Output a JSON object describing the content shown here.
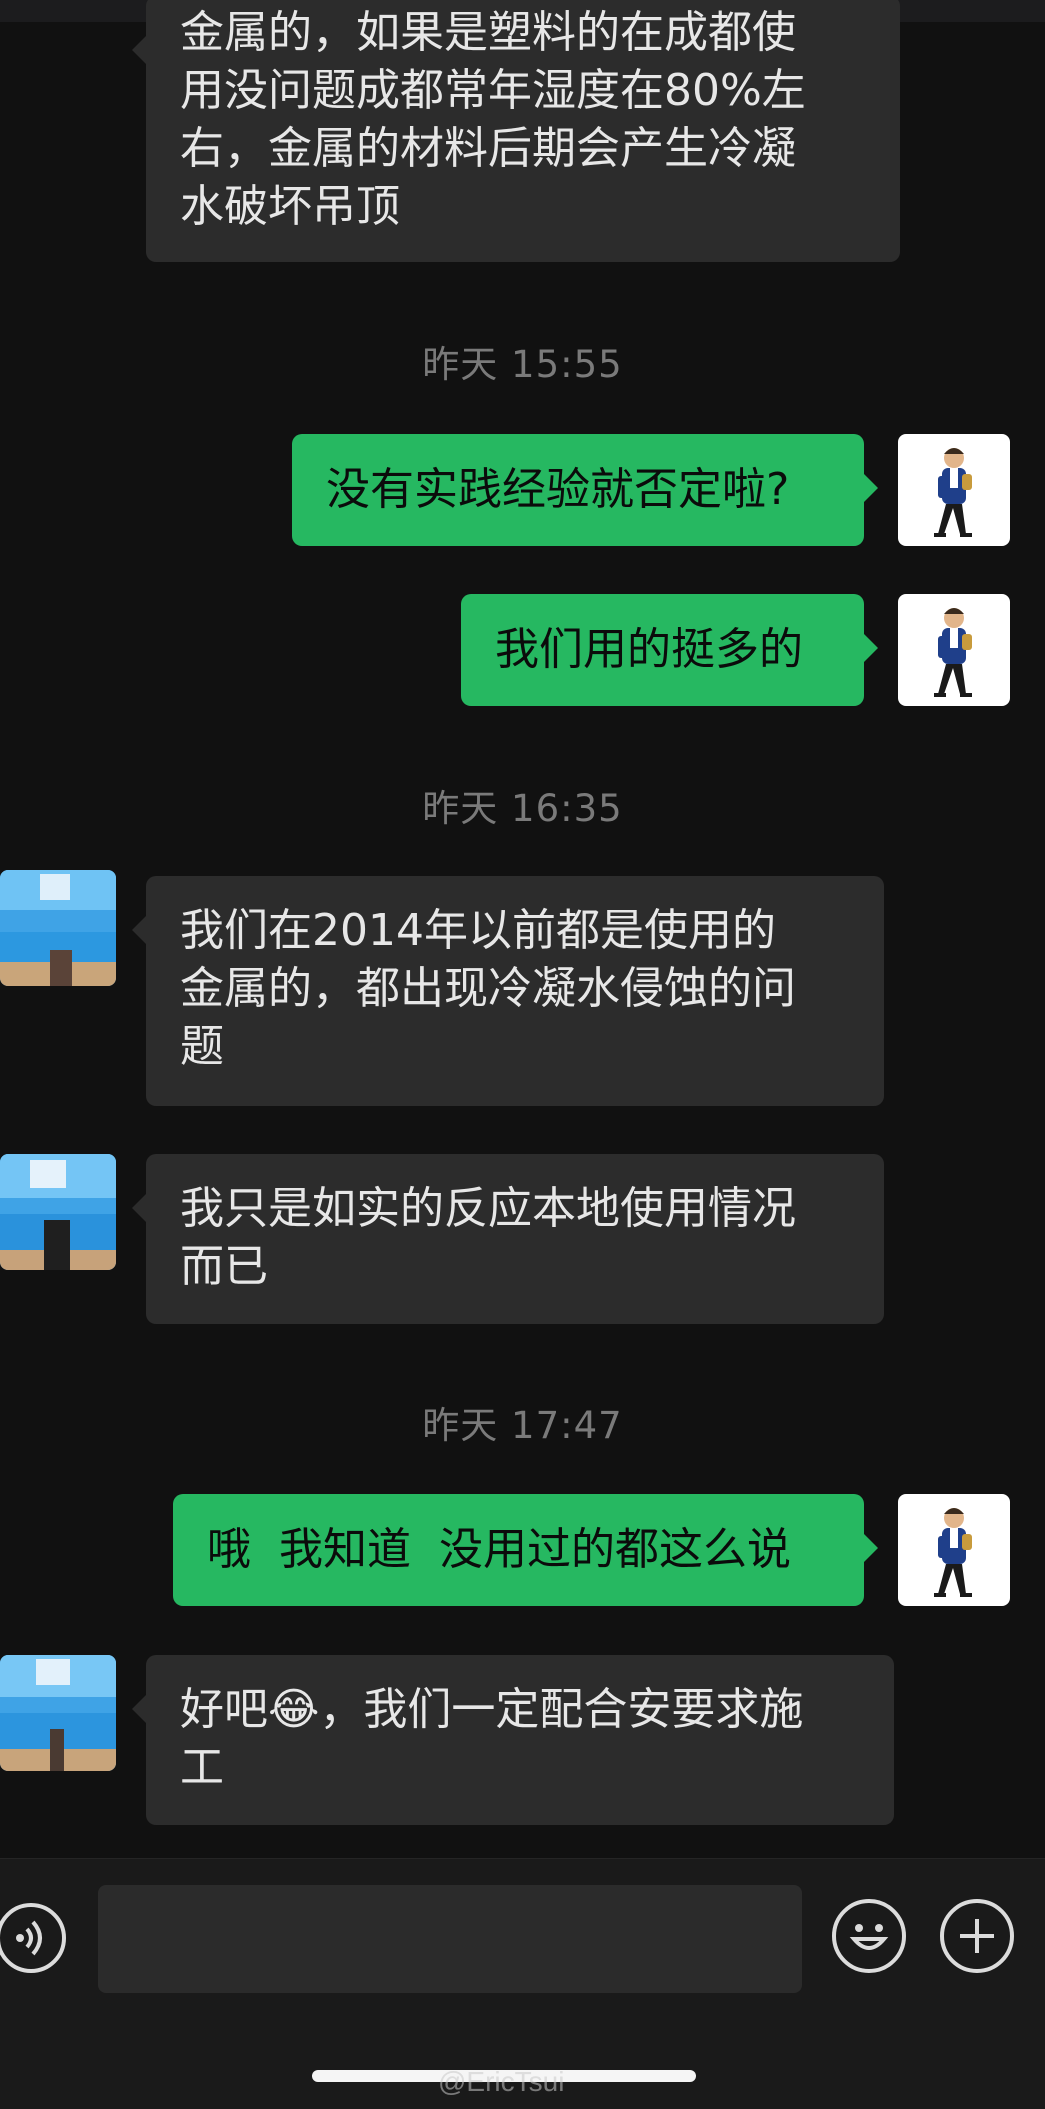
{
  "colors": {
    "background": "#111111",
    "sent_bubble": "#26b861",
    "received_bubble": "#2c2c2c",
    "timestamp": "#7a7a7a"
  },
  "messages": [
    {
      "type": "received",
      "text": "金属的，如果是塑料的在成都使\n用没问题成都常年湿度在80%左\n右，金属的材料后期会产生冷凝\n水破坏吊顶"
    },
    {
      "type": "time",
      "text": "昨天 15:55"
    },
    {
      "type": "sent",
      "text": "没有实践经验就否定啦?"
    },
    {
      "type": "sent",
      "text": "我们用的挺多的"
    },
    {
      "type": "time",
      "text": "昨天 16:35"
    },
    {
      "type": "received",
      "text": "我们在2014年以前都是使用的\n金属的，都出现冷凝水侵蚀的问\n题"
    },
    {
      "type": "received",
      "text": "我只是如实的反应本地使用情况\n而已"
    },
    {
      "type": "time",
      "text": "昨天 17:47"
    },
    {
      "type": "sent",
      "text": "哦  我知道  没用过的都这么说"
    },
    {
      "type": "received",
      "text": "好吧😂，我们一定配合安要求施\n工"
    }
  ],
  "input_bar": {
    "voice_icon": "voice-icon",
    "emoji_icon": "emoji-icon",
    "plus_icon": "plus-icon",
    "text_value": ""
  },
  "watermark": "@EricTsui"
}
